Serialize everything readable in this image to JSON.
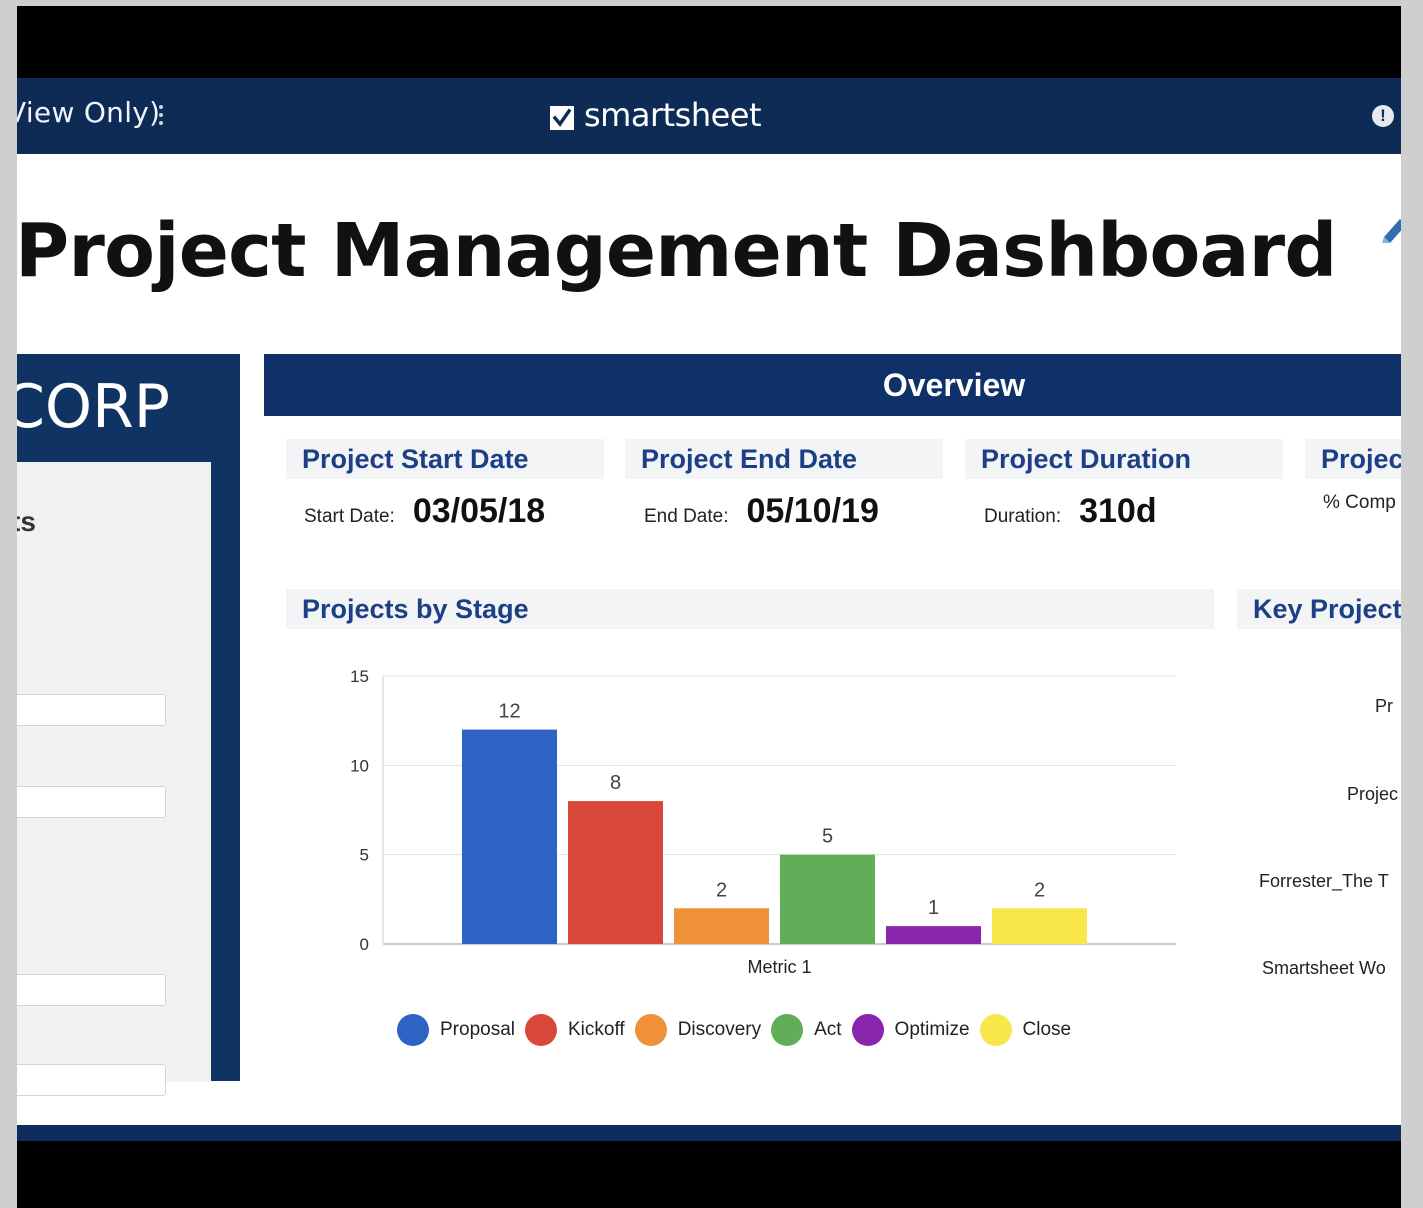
{
  "header": {
    "view_only": "View Only)",
    "brand": "smartsheet"
  },
  "page_title": "Project Management Dashboard",
  "left_panel": {
    "corp": "CORP",
    "card_label": "ts"
  },
  "overview": {
    "title": "Overview"
  },
  "cards": [
    {
      "title": "Project Start Date",
      "label": "Start Date:",
      "value": "03/05/18"
    },
    {
      "title": "Project End Date",
      "label": "End Date:",
      "value": "05/10/19"
    },
    {
      "title": "Project Duration",
      "label": "Duration:",
      "value": "310d"
    },
    {
      "title": "Projec",
      "label": "% Comp",
      "value": ""
    }
  ],
  "chart_panel": {
    "title": "Projects by Stage"
  },
  "key_projects": {
    "title": "Key Project",
    "items": [
      "Pr",
      "Projec",
      "Forrester_The T",
      "Smartsheet Wo"
    ]
  },
  "chart_data": {
    "type": "bar",
    "xlabel": "Metric 1",
    "ylabel": "",
    "ylim": [
      0,
      15
    ],
    "yticks": [
      0,
      5,
      10,
      15
    ],
    "grid": true,
    "legend_position": "bottom",
    "categories": [
      "Metric 1"
    ],
    "series": [
      {
        "name": "Proposal",
        "values": [
          12
        ],
        "color": "#2d64c3"
      },
      {
        "name": "Kickoff",
        "values": [
          8
        ],
        "color": "#d9463a"
      },
      {
        "name": "Discovery",
        "values": [
          2
        ],
        "color": "#f0913a"
      },
      {
        "name": "Act",
        "values": [
          5
        ],
        "color": "#62ad58"
      },
      {
        "name": "Optimize",
        "values": [
          1
        ],
        "color": "#8a25ad"
      },
      {
        "name": "Close",
        "values": [
          2
        ],
        "color": "#f8e74a"
      }
    ]
  },
  "colors": {
    "header_bg": "#0d2b55",
    "accent_blue": "#1c3f86",
    "overview_bg": "#10306a"
  },
  "icons": {
    "kebab": "kebab-menu-icon",
    "alert": "alert-icon",
    "logo": "smartsheet-logo-icon"
  }
}
